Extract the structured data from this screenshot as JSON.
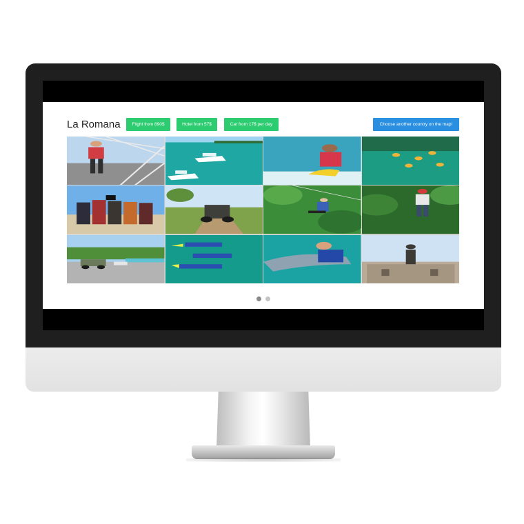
{
  "page": {
    "title": "La Romana"
  },
  "offers": {
    "flight": "Flight from 890$",
    "hotel": "Hotel from 57$",
    "car": "Car from 17$ per day",
    "map_link": "Choose another country on the map!"
  },
  "colors": {
    "offer_button": "#2ecc71",
    "map_button": "#2a8fe0",
    "active_dot": "#8a8a8a",
    "inactive_dot": "#c4c4c4"
  },
  "gallery": {
    "photos": [
      {
        "subject": "zipline harness"
      },
      {
        "subject": "speedboats on turquoise sea"
      },
      {
        "subject": "banana boat ride"
      },
      {
        "subject": "snorkeling from above"
      },
      {
        "subject": "pirate show group"
      },
      {
        "subject": "buggy on dirt road"
      },
      {
        "subject": "zipline over jungle"
      },
      {
        "subject": "zipline in forest"
      },
      {
        "subject": "coastal road with cars"
      },
      {
        "subject": "snorkeling divers"
      },
      {
        "subject": "swimming with dolphin"
      },
      {
        "subject": "statue at historic building"
      }
    ]
  },
  "carousel": {
    "total_slides": 2,
    "active_slide": 1
  }
}
